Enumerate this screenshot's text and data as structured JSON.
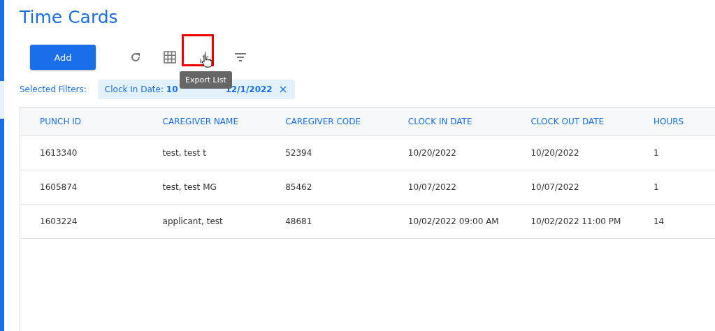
{
  "title": "Time Cards",
  "toolbar": {
    "add_button": "Add",
    "tooltip": "Export List"
  },
  "filters": {
    "label": "Selected Filters:",
    "chip_start": "Clock In Date: **10**",
    "chip_end": "12/1/2022"
  },
  "table": {
    "columns": [
      "PUNCH ID",
      "CAREGIVER NAME",
      "CAREGIVER CODE",
      "CLOCK IN DATE",
      "CLOCK OUT DATE",
      "HOURS"
    ],
    "rows": [
      [
        "1613340",
        "test, test t",
        "52394",
        "10/20/2022",
        "10/20/2022",
        "1"
      ],
      [
        "1605874",
        "test, test MG",
        "85462",
        "10/07/2022",
        "10/07/2022",
        "1"
      ],
      [
        "1603224",
        "applicant, test",
        "48681",
        "10/02/2022 09:00 AM",
        "10/02/2022 11:00 PM",
        "14"
      ]
    ]
  }
}
